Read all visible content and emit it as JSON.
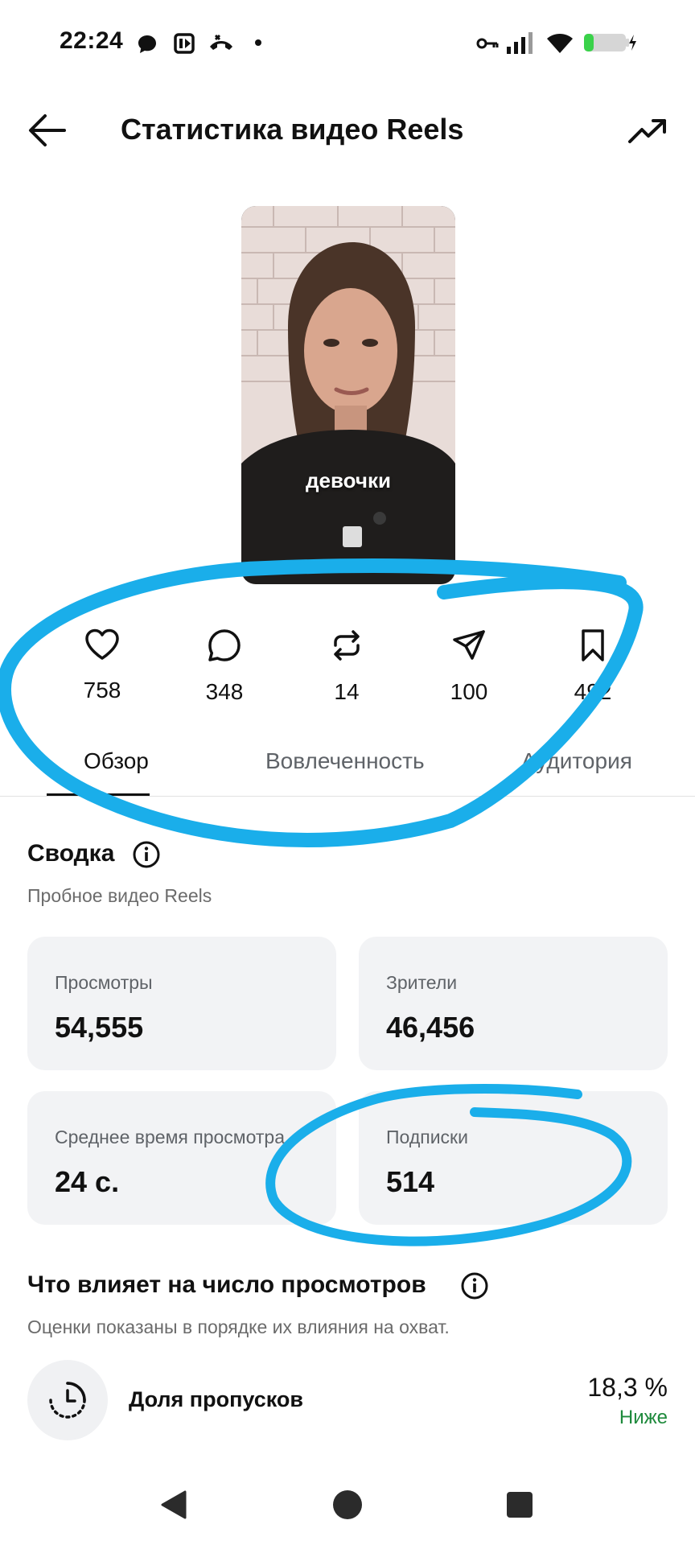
{
  "status_bar": {
    "time": "22:24",
    "icons": [
      "chat-icon",
      "media-icon",
      "call-icon",
      "dot-icon",
      "key-icon",
      "signal-icon",
      "wifi-icon",
      "battery-icon"
    ]
  },
  "header": {
    "title": "Статистика видео Reels",
    "back_icon": "back-arrow-icon",
    "trend_icon": "trending-icon"
  },
  "thumbnail": {
    "caption": "девочки"
  },
  "stats": [
    {
      "icon": "heart-icon",
      "value": "758"
    },
    {
      "icon": "comment-icon",
      "value": "348"
    },
    {
      "icon": "repost-icon",
      "value": "14"
    },
    {
      "icon": "share-icon",
      "value": "100"
    },
    {
      "icon": "bookmark-icon",
      "value": "492"
    }
  ],
  "tabs": [
    {
      "label": "Обзор",
      "active": true
    },
    {
      "label": "Вовлеченность",
      "active": false
    },
    {
      "label": "Аудитория",
      "active": false
    }
  ],
  "summary": {
    "title": "Сводка",
    "subtitle": "Пробное видео Reels",
    "cards": [
      {
        "label": "Просмотры",
        "value": "54,555"
      },
      {
        "label": "Зрители",
        "value": "46,456"
      },
      {
        "label": "Среднее время просмотра",
        "value": "24 с."
      },
      {
        "label": "Подписки",
        "value": "514"
      }
    ]
  },
  "factors": {
    "title": "Что влияет на число просмотров",
    "subtitle": "Оценки показаны в порядке их влияния на охват.",
    "items": [
      {
        "icon": "clock-icon",
        "name": "Доля пропусков",
        "value": "18,3 %",
        "trend": "Ниже"
      }
    ]
  },
  "nav": {
    "back": "nav-back-icon",
    "home": "nav-home-icon",
    "recents": "nav-recents-icon"
  },
  "colors": {
    "annotation": "#1AAEEA",
    "trend_positive": "#1E8A3C",
    "card_bg": "#F2F3F5"
  }
}
